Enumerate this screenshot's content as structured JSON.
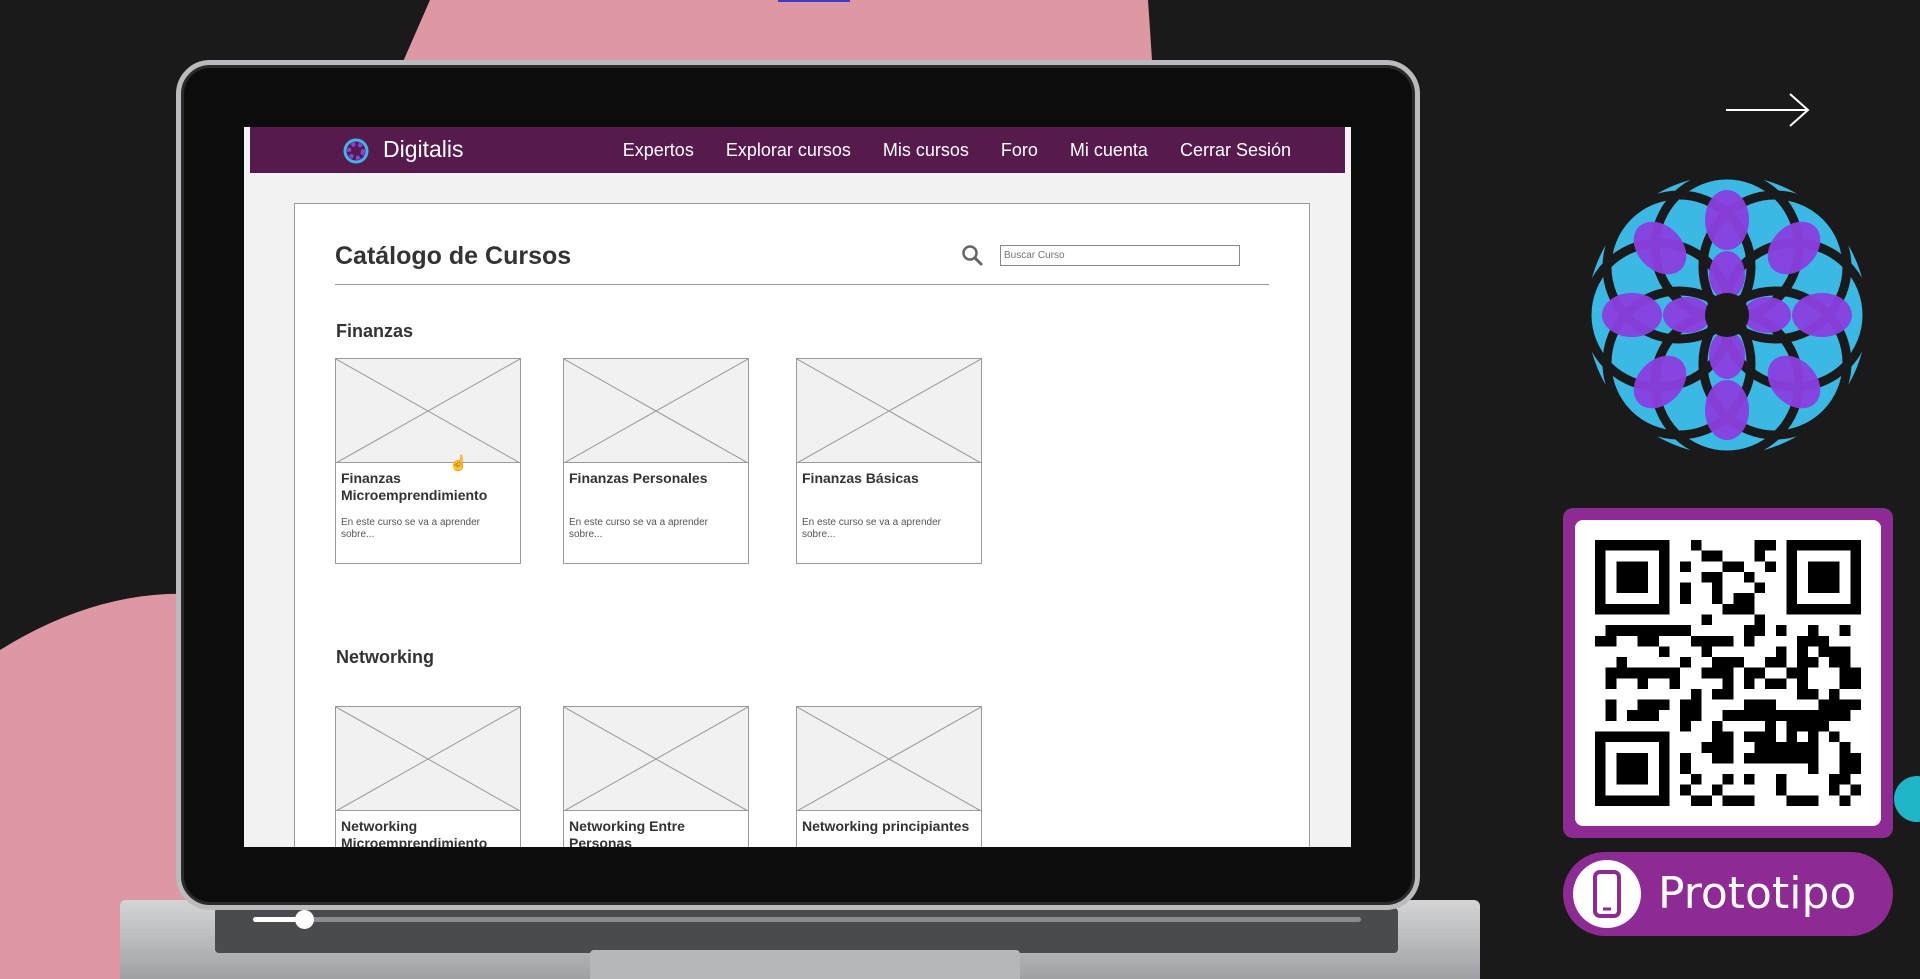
{
  "colors": {
    "background": "#1a1a1a",
    "pink_shape": "#dd98a4",
    "nav_bar": "#561a4c",
    "accent_purple": "#8e2a94",
    "logo_purple": "#8b3fe0",
    "logo_cyan": "#3ab9e4"
  },
  "site": {
    "brand": "Digitalis",
    "nav": [
      "Expertos",
      "Explorar cursos",
      "Mis cursos",
      "Foro",
      "Mi cuenta",
      "Cerrar Sesión"
    ]
  },
  "catalog": {
    "title": "Catálogo de Cursos",
    "search_placeholder": "Buscar Curso",
    "sections": [
      {
        "name": "Finanzas",
        "courses": [
          {
            "title": "Finanzas Microemprendimiento",
            "desc": "En este curso se va a aprender sobre..."
          },
          {
            "title": "Finanzas Personales",
            "desc": "En este curso se va a aprender sobre..."
          },
          {
            "title": "Finanzas Básicas",
            "desc": "En este curso se va a aprender sobre..."
          }
        ]
      },
      {
        "name": "Networking",
        "courses": [
          {
            "title": "Networking Microemprendimiento",
            "desc": ""
          },
          {
            "title": "Networking Entre Personas",
            "desc": ""
          },
          {
            "title": "Networking principiantes",
            "desc": ""
          }
        ]
      }
    ]
  },
  "player": {
    "progress": 0.04
  },
  "prototype_button": {
    "label": "Prototipo",
    "icon": "smartphone-icon"
  },
  "icons": {
    "next": "arrow-right-icon",
    "search": "search-icon",
    "qr": "qr-code",
    "logo": "digitalis-logo"
  }
}
